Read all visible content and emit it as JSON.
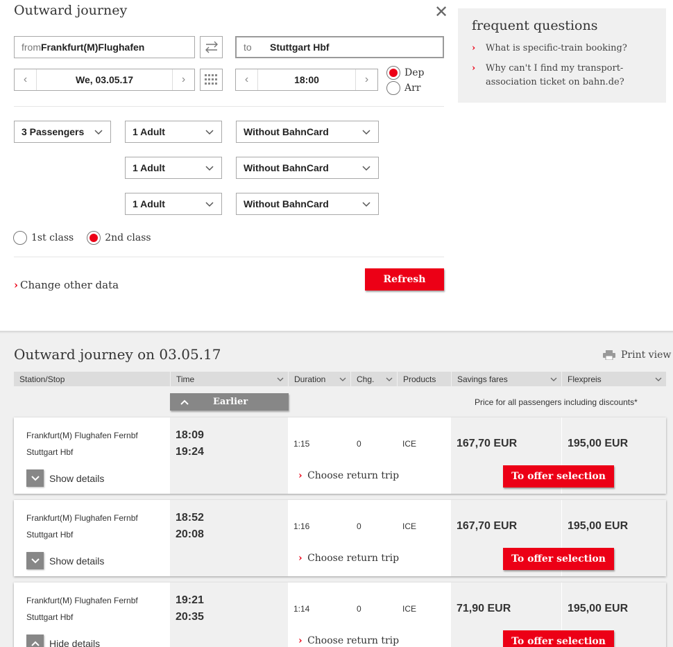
{
  "search": {
    "title": "Outward journey",
    "from_prefix": "from",
    "from_value": "Frankfurt(M)Flughafen",
    "to_prefix": "to",
    "to_value": "Stuttgart Hbf",
    "date": "We, 03.05.17",
    "time": "18:00",
    "dep_label": "Dep",
    "arr_label": "Arr",
    "passengers": "3 Passengers",
    "traveller_rows": [
      {
        "type": "1 Adult",
        "card": "Without BahnCard"
      },
      {
        "type": "1 Adult",
        "card": "Without BahnCard"
      },
      {
        "type": "1 Adult",
        "card": "Without BahnCard"
      }
    ],
    "class1": "1st class",
    "class2": "2nd class",
    "change_data": "Change other data",
    "refresh": "Refresh"
  },
  "faq": {
    "title": "frequent questions",
    "items": [
      "What is specific-train booking?",
      "Why can't I find my transport-association ticket on bahn.de?"
    ]
  },
  "results": {
    "title": "Outward journey on 03.05.17",
    "print": "Print view",
    "columns": [
      "Station/Stop",
      "Time",
      "Duration",
      "Chg.",
      "Products",
      "Savings fares",
      "Flexpreis"
    ],
    "earlier": "Earlier",
    "price_note": "Price for all passengers including discounts*",
    "connections": [
      {
        "from": "Frankfurt(M) Flughafen Fernbf",
        "to": "Stuttgart Hbf",
        "dep": "18:09",
        "arr": "19:24",
        "duration": "1:15",
        "changes": "0",
        "product": "ICE",
        "saving": "167,70 EUR",
        "flex": "195,00 EUR",
        "details": "Show details",
        "return": "Choose return trip",
        "offer": "To offer selection"
      },
      {
        "from": "Frankfurt(M) Flughafen Fernbf",
        "to": "Stuttgart Hbf",
        "dep": "18:52",
        "arr": "20:08",
        "duration": "1:16",
        "changes": "0",
        "product": "ICE",
        "saving": "167,70 EUR",
        "flex": "195,00 EUR",
        "details": "Show details",
        "return": "Choose return trip",
        "offer": "To offer selection"
      },
      {
        "from": "Frankfurt(M) Flughafen Fernbf",
        "to": "Stuttgart Hbf",
        "dep": "19:21",
        "arr": "20:35",
        "duration": "1:14",
        "changes": "0",
        "product": "ICE",
        "saving": "71,90 EUR",
        "flex": "195,00 EUR",
        "details": "Hide details",
        "return": "Choose return trip",
        "offer": "To offer selection"
      }
    ]
  },
  "colors": {
    "accent": "#ec0016",
    "panel": "#f0f0f0",
    "button_grey": "#878787"
  }
}
